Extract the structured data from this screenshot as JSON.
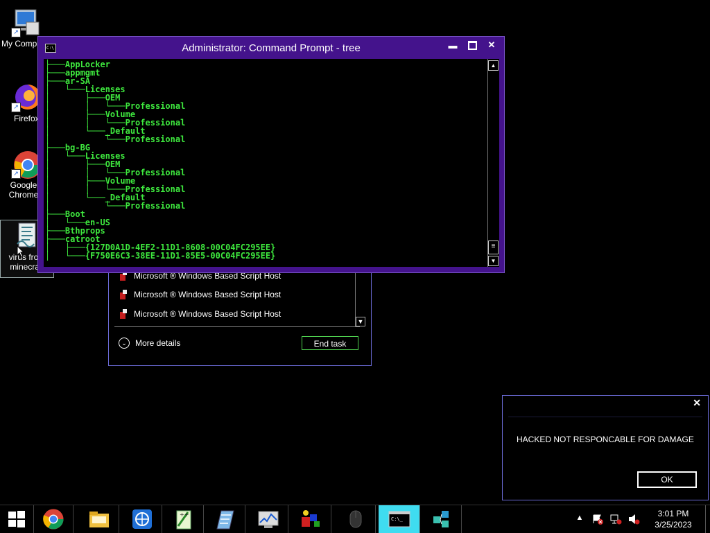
{
  "desktop": {
    "icons": [
      {
        "label": "My Computer",
        "icon": "computer-icon"
      },
      {
        "label": "Firefox",
        "icon": "firefox-icon"
      },
      {
        "label": "Google Chrome",
        "icon": "chrome-icon"
      },
      {
        "label": "virus from minecraft",
        "icon": "script-file-icon"
      }
    ]
  },
  "task_manager": {
    "rows": [
      {
        "label": "Microsoft ® Windows Based Script Host",
        "icon": "script-host-icon"
      },
      {
        "label": "Microsoft ® Windows Based Script Host",
        "icon": "script-host-icon"
      },
      {
        "label": "Microsoft ® Windows Based Script Host",
        "icon": "script-host-icon"
      }
    ],
    "more_details": "More details",
    "end_task": "End task"
  },
  "cmd": {
    "title": "Administrator:  Command Prompt - tree",
    "icon_text": "C:\\",
    "output": [
      "├───AppLocker",
      "├───appmgmt",
      "├───ar-SA",
      "│   └───Licenses",
      "│       ├───OEM",
      "│       │   └───Professional",
      "│       ├───Volume",
      "│       │   └───Professional",
      "│       └───_Default",
      "│           └───Professional",
      "├───bg-BG",
      "│   └───Licenses",
      "│       ├───OEM",
      "│       │   └───Professional",
      "│       ├───Volume",
      "│       │   └───Professional",
      "│       └───_Default",
      "│           └───Professional",
      "├───Boot",
      "│   └───en-US",
      "├───Bthprops",
      "├───catroot",
      "│   ├───{127D0A1D-4EF2-11D1-8608-00C04FC295EE}",
      "│   └───{F750E6C3-38EE-11D1-85E5-00C04FC295EE}"
    ]
  },
  "dialog": {
    "message": "HACKED NOT RESPONCABLE FOR DAMAGE",
    "ok": "OK"
  },
  "taskbar": {
    "buttons": [
      {
        "icon": "windows-start-icon"
      },
      {
        "icon": "chrome-icon"
      },
      {
        "icon": "file-explorer-icon"
      },
      {
        "icon": "network-globe-icon"
      },
      {
        "icon": "notepad-plus-plus-icon"
      },
      {
        "icon": "notepad-icon"
      },
      {
        "icon": "task-manager-icon"
      },
      {
        "icon": "paint-shapes-icon"
      },
      {
        "icon": "mouse-icon"
      },
      {
        "icon": "command-prompt-icon",
        "active": true
      },
      {
        "icon": "network-cubes-icon"
      }
    ],
    "time": "3:01 PM",
    "date": "3/25/2023"
  }
}
